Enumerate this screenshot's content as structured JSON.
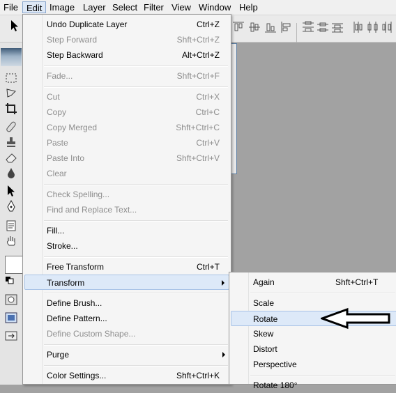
{
  "menubar": {
    "items": [
      "File",
      "Edit",
      "Image",
      "Layer",
      "Select",
      "Filter",
      "View",
      "Window",
      "Help"
    ],
    "active": "Edit"
  },
  "edit_menu": {
    "items": [
      {
        "label": "Undo Duplicate Layer",
        "shortcut": "Ctrl+Z",
        "enabled": true
      },
      {
        "label": "Step Forward",
        "shortcut": "Shft+Ctrl+Z",
        "enabled": false
      },
      {
        "label": "Step Backward",
        "shortcut": "Alt+Ctrl+Z",
        "enabled": true
      },
      {
        "label": "Fade...",
        "shortcut": "Shft+Ctrl+F",
        "enabled": false
      },
      {
        "label": "Cut",
        "shortcut": "Ctrl+X",
        "enabled": false
      },
      {
        "label": "Copy",
        "shortcut": "Ctrl+C",
        "enabled": false
      },
      {
        "label": "Copy Merged",
        "shortcut": "Shft+Ctrl+C",
        "enabled": false
      },
      {
        "label": "Paste",
        "shortcut": "Ctrl+V",
        "enabled": false
      },
      {
        "label": "Paste Into",
        "shortcut": "Shft+Ctrl+V",
        "enabled": false
      },
      {
        "label": "Clear",
        "shortcut": "",
        "enabled": false
      },
      {
        "label": "Check Spelling...",
        "shortcut": "",
        "enabled": false
      },
      {
        "label": "Find and Replace Text...",
        "shortcut": "",
        "enabled": false
      },
      {
        "label": "Fill...",
        "shortcut": "",
        "enabled": true
      },
      {
        "label": "Stroke...",
        "shortcut": "",
        "enabled": true
      },
      {
        "label": "Free Transform",
        "shortcut": "Ctrl+T",
        "enabled": true
      },
      {
        "label": "Transform",
        "shortcut": "",
        "enabled": true,
        "submenu": true,
        "highlighted": true
      },
      {
        "label": "Define Brush...",
        "shortcut": "",
        "enabled": true
      },
      {
        "label": "Define Pattern...",
        "shortcut": "",
        "enabled": true
      },
      {
        "label": "Define Custom Shape...",
        "shortcut": "",
        "enabled": false
      },
      {
        "label": "Purge",
        "shortcut": "",
        "enabled": true,
        "submenu": true
      },
      {
        "label": "Color Settings...",
        "shortcut": "Shft+Ctrl+K",
        "enabled": true
      }
    ]
  },
  "transform_submenu": {
    "items": [
      {
        "label": "Again",
        "shortcut": "Shft+Ctrl+T"
      },
      {
        "label": "Scale",
        "shortcut": ""
      },
      {
        "label": "Rotate",
        "shortcut": "",
        "highlighted": true
      },
      {
        "label": "Skew",
        "shortcut": ""
      },
      {
        "label": "Distort",
        "shortcut": ""
      },
      {
        "label": "Perspective",
        "shortcut": ""
      },
      {
        "label": "Rotate 180°",
        "shortcut": ""
      }
    ]
  },
  "colors": {
    "highlight_bg": "#dde9f8",
    "highlight_border": "#a8c3e6",
    "disabled_text": "#8d8d8d",
    "workspace_bg": "#a2a2a2"
  }
}
